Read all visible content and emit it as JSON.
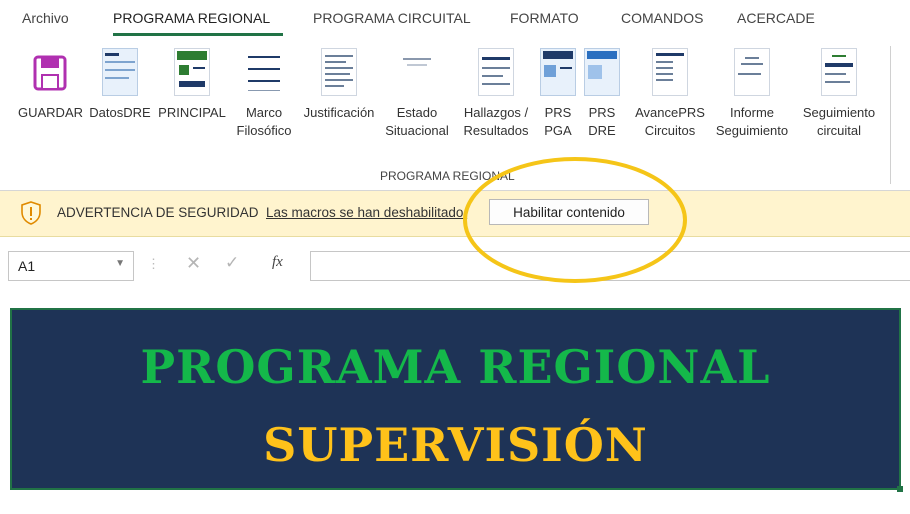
{
  "tabs": [
    {
      "label": "Archivo"
    },
    {
      "label": "PROGRAMA REGIONAL"
    },
    {
      "label": "PROGRAMA CIRCUITAL"
    },
    {
      "label": "FORMATO"
    },
    {
      "label": "COMANDOS"
    },
    {
      "label": "ACERCADE"
    }
  ],
  "ribbon": {
    "buttons": [
      {
        "label": "GUARDAR",
        "label2": ""
      },
      {
        "label": "DatosDRE",
        "label2": ""
      },
      {
        "label": "PRINCIPAL",
        "label2": ""
      },
      {
        "label": "Marco",
        "label2": "Filosófico"
      },
      {
        "label": "Justificación",
        "label2": ""
      },
      {
        "label": "Estado",
        "label2": "Situacional"
      },
      {
        "label": "Hallazgos /",
        "label2": "Resultados"
      },
      {
        "label": "PRS",
        "label2": "PGA"
      },
      {
        "label": "PRS",
        "label2": "DRE"
      },
      {
        "label": "AvancePRS",
        "label2": "Circuitos"
      },
      {
        "label": "Informe",
        "label2": "Seguimiento"
      },
      {
        "label": "Seguimiento",
        "label2": "circuital"
      }
    ],
    "group_label": "PROGRAMA REGIONAL"
  },
  "security": {
    "title": "ADVERTENCIA DE SEGURIDAD",
    "message": "Las macros se han deshabilitado.",
    "button": "Habilitar contenido"
  },
  "formula_bar": {
    "name_box": "A1",
    "fx": "fx",
    "cancel": "✕",
    "enter": "✓",
    "formula": ""
  },
  "sheet": {
    "line1": "PROGRAMA REGIONAL",
    "line2": "SUPERVISIÓN"
  },
  "colors": {
    "accent": "#217346",
    "banner_bg": "#1e3356",
    "line1": "#14b84a",
    "line2": "#ffc21a",
    "annotation": "#f5c518",
    "security_bg": "#fff4ce"
  }
}
